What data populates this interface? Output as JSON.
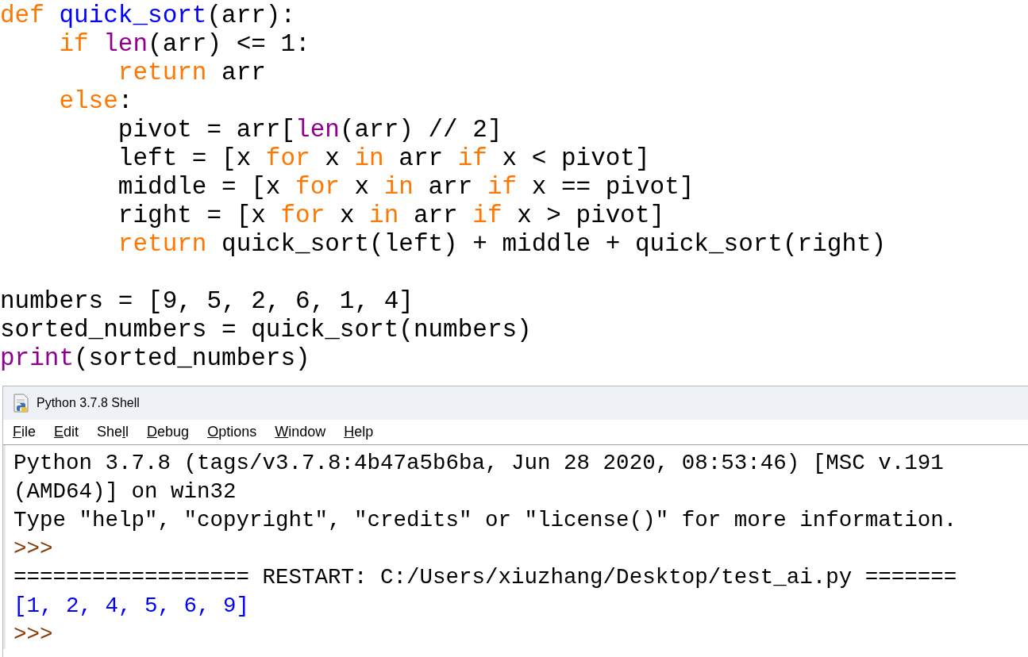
{
  "editor": {
    "lines": [
      {
        "tokens": [
          {
            "kind": "keyword",
            "text": "def "
          },
          {
            "kind": "defname",
            "text": "quick_sort"
          },
          {
            "kind": "plain",
            "text": "(arr):"
          }
        ]
      },
      {
        "tokens": [
          {
            "kind": "keyword",
            "text": "    if "
          },
          {
            "kind": "builtin",
            "text": "len"
          },
          {
            "kind": "plain",
            "text": "(arr) <= 1:"
          }
        ]
      },
      {
        "tokens": [
          {
            "kind": "keyword",
            "text": "        return"
          },
          {
            "kind": "plain",
            "text": " arr"
          }
        ]
      },
      {
        "tokens": [
          {
            "kind": "keyword",
            "text": "    else"
          },
          {
            "kind": "plain",
            "text": ":"
          }
        ]
      },
      {
        "tokens": [
          {
            "kind": "plain",
            "text": "        pivot = arr["
          },
          {
            "kind": "builtin",
            "text": "len"
          },
          {
            "kind": "plain",
            "text": "(arr) // 2]"
          }
        ]
      },
      {
        "tokens": [
          {
            "kind": "plain",
            "text": "        left = [x "
          },
          {
            "kind": "keyword",
            "text": "for"
          },
          {
            "kind": "plain",
            "text": " x "
          },
          {
            "kind": "keyword",
            "text": "in"
          },
          {
            "kind": "plain",
            "text": " arr "
          },
          {
            "kind": "keyword",
            "text": "if"
          },
          {
            "kind": "plain",
            "text": " x < pivot]"
          }
        ]
      },
      {
        "tokens": [
          {
            "kind": "plain",
            "text": "        middle = [x "
          },
          {
            "kind": "keyword",
            "text": "for"
          },
          {
            "kind": "plain",
            "text": " x "
          },
          {
            "kind": "keyword",
            "text": "in"
          },
          {
            "kind": "plain",
            "text": " arr "
          },
          {
            "kind": "keyword",
            "text": "if"
          },
          {
            "kind": "plain",
            "text": " x == pivot]"
          }
        ]
      },
      {
        "tokens": [
          {
            "kind": "plain",
            "text": "        right = [x "
          },
          {
            "kind": "keyword",
            "text": "for"
          },
          {
            "kind": "plain",
            "text": " x "
          },
          {
            "kind": "keyword",
            "text": "in"
          },
          {
            "kind": "plain",
            "text": " arr "
          },
          {
            "kind": "keyword",
            "text": "if"
          },
          {
            "kind": "plain",
            "text": " x > pivot]"
          }
        ]
      },
      {
        "tokens": [
          {
            "kind": "keyword",
            "text": "        return"
          },
          {
            "kind": "plain",
            "text": " quick_sort(left) + middle + quick_sort(right)"
          }
        ]
      },
      {
        "gap_before": true,
        "tokens": [
          {
            "kind": "plain",
            "text": "numbers = [9, 5, 2, 6, 1, 4]"
          }
        ]
      },
      {
        "tokens": [
          {
            "kind": "plain",
            "text": "sorted_numbers = quick_sort(numbers)"
          }
        ]
      },
      {
        "tokens": [
          {
            "kind": "builtin",
            "text": "print"
          },
          {
            "kind": "plain",
            "text": "(sorted_numbers)"
          }
        ]
      }
    ]
  },
  "shell": {
    "title": "Python 3.7.8 Shell",
    "menu": [
      {
        "key": "F",
        "after": "ile"
      },
      {
        "key": "E",
        "after": "dit"
      },
      {
        "before": "She",
        "key": "l",
        "after": "l"
      },
      {
        "key": "D",
        "after": "ebug"
      },
      {
        "key": "O",
        "after": "ptions"
      },
      {
        "key": "W",
        "after": "indow"
      },
      {
        "key": "H",
        "after": "elp"
      }
    ],
    "lines": [
      {
        "kind": "output",
        "text": "Python 3.7.8 (tags/v3.7.8:4b47a5b6ba, Jun 28 2020, 08:53:46) [MSC v.191"
      },
      {
        "kind": "output",
        "text": "(AMD64)] on win32"
      },
      {
        "kind": "output",
        "text": "Type \"help\", \"copyright\", \"credits\" or \"license()\" for more information."
      },
      {
        "kind": "prompt",
        "text": ">>>"
      },
      {
        "kind": "output",
        "text": "================== RESTART: C:/Users/xiuzhang/Desktop/test_ai.py ======="
      },
      {
        "kind": "result",
        "text": "[1, 2, 4, 5, 6, 9]"
      },
      {
        "kind": "prompt",
        "text": ">>>"
      }
    ]
  }
}
